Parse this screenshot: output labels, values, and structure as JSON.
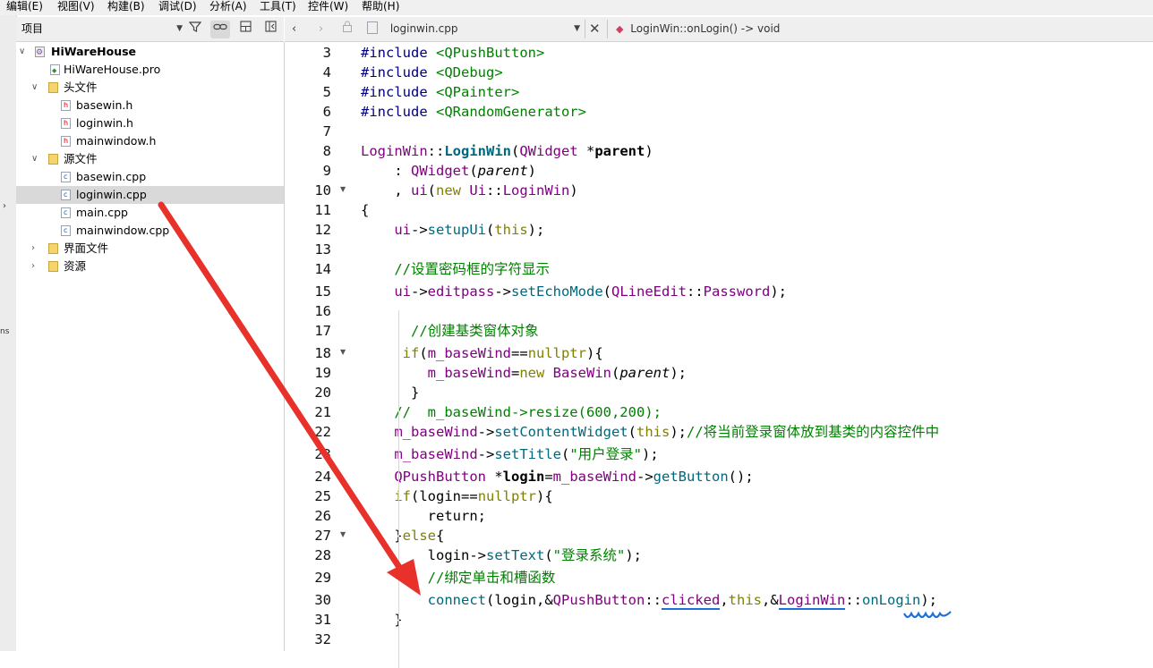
{
  "menubar": {
    "items": [
      "编辑(E)",
      "视图(V)",
      "构建(B)",
      "调试(D)",
      "分析(A)",
      "工具(T)",
      "控件(W)",
      "帮助(H)"
    ]
  },
  "leftstrip": {
    "marker": "ns"
  },
  "project_panel": {
    "combo_label": "项目",
    "tree": {
      "root": "HiWareHouse",
      "pro_file": "HiWareHouse.pro",
      "headers_folder": "头文件",
      "headers": [
        "basewin.h",
        "loginwin.h",
        "mainwindow.h"
      ],
      "sources_folder": "源文件",
      "sources": [
        "basewin.cpp",
        "loginwin.cpp",
        "main.cpp",
        "mainwindow.cpp"
      ],
      "forms_folder": "界面文件",
      "resources_folder": "资源"
    },
    "selected_item": "loginwin.cpp"
  },
  "editor_toolbar": {
    "file_name": "loginwin.cpp",
    "symbol": "LoginWin::onLogin() -> void"
  },
  "editor": {
    "line_numbers": [
      "3",
      "4",
      "5",
      "6",
      "7",
      "8",
      "9",
      "10",
      "11",
      "12",
      "13",
      "14",
      "15",
      "16",
      "17",
      "18",
      "19",
      "20",
      "21",
      "22",
      "23",
      "24",
      "25",
      "26",
      "27",
      "28",
      "29",
      "30",
      "31",
      "32"
    ],
    "code": {
      "inc_kw": "#include",
      "inc1": "<QPushButton>",
      "inc2": "<QDebug>",
      "inc3": "<QPainter>",
      "inc4": "<QRandomGenerator>",
      "l8_cls": "LoginWin",
      "l8_sep": "::",
      "l8_fn": "LoginWin",
      "l8_open": "(",
      "l8_type": "QWidget",
      "l8_star": " *",
      "l8_param": "parent",
      "l8_close": ")",
      "l9_colon": "    : ",
      "l9_type": "QWidget",
      "l9_open": "(",
      "l9_param": "parent",
      "l9_close": ")",
      "l10_comma": "    , ",
      "l10_ui": "ui",
      "l10_open": "(",
      "l10_new": "new",
      "l10_ns": "Ui",
      "l10_sep": "::",
      "l10_cls": "LoginWin",
      "l10_close": ")",
      "l11": "{",
      "l12_ui": "ui",
      "l12_arrow": "->",
      "l12_fn": "setupUi",
      "l12_open": "(",
      "l12_this": "this",
      "l12_close": ");",
      "l14": "//设置密码框的字符显示",
      "l15_ui": "ui",
      "l15_a1": "->",
      "l15_ep": "editpass",
      "l15_a2": "->",
      "l15_fn": "setEchoMode",
      "l15_open": "(",
      "l15_cls": "QLineEdit",
      "l15_sep": "::",
      "l15_en": "Password",
      "l15_close": ");",
      "l17": "//创建基类窗体对象",
      "l18_if": "if",
      "l18_open": "(",
      "l18_var": "m_baseWind",
      "l18_eq": "==",
      "l18_null": "nullptr",
      "l18_close": "){",
      "l19_var": "m_baseWind",
      "l19_eq": "=",
      "l19_new": "new",
      "l19_cls": "BaseWin",
      "l19_open": "(",
      "l19_param": "parent",
      "l19_close": ");",
      "l20": "}",
      "l21": "//  m_baseWind->resize(600,200);",
      "l22_var": "m_baseWind",
      "l22_arrow": "->",
      "l22_fn": "setContentWidget",
      "l22_open": "(",
      "l22_this": "this",
      "l22_close": ");",
      "l22_cmt": "//将当前登录窗体放到基类的内容控件中",
      "l23_var": "m_baseWind",
      "l23_arrow": "->",
      "l23_fn": "setTitle",
      "l23_open": "(",
      "l23_str": "\"用户登录\"",
      "l23_close": ");",
      "l24_cls": "QPushButton",
      "l24_star": " *",
      "l24_var": "login",
      "l24_eq": "=",
      "l24_base": "m_baseWind",
      "l24_arrow": "->",
      "l24_fn": "getButton",
      "l24_close": "();",
      "l25_if": "if",
      "l25_open": "(",
      "l25_var": "login",
      "l25_eq": "==",
      "l25_null": "nullptr",
      "l25_close": "){",
      "l26": "return;",
      "l27_close": "}",
      "l27_else": "else",
      "l27_open": "{",
      "l28_var": "login",
      "l28_arrow": "->",
      "l28_fn": "setText",
      "l28_open": "(",
      "l28_str": "\"登录系统\"",
      "l28_close": ");",
      "l29": "//绑定单击和槽函数",
      "l30_fn": "connect",
      "l30_open": "(",
      "l30_login": "login",
      "l30_c1": ",&",
      "l30_cls": "QPushButton",
      "l30_sep1": "::",
      "l30_sig": "clicked",
      "l30_c2": ",",
      "l30_this": "this",
      "l30_c3": ",&",
      "l30_cls2": "LoginWin",
      "l30_sep2": "::",
      "l30_slot": "onLogin",
      "l30_close": ");",
      "l31": "}"
    }
  },
  "annotation": {
    "arrow_color": "#e8312a",
    "underline_color": "#1f6fd9"
  }
}
